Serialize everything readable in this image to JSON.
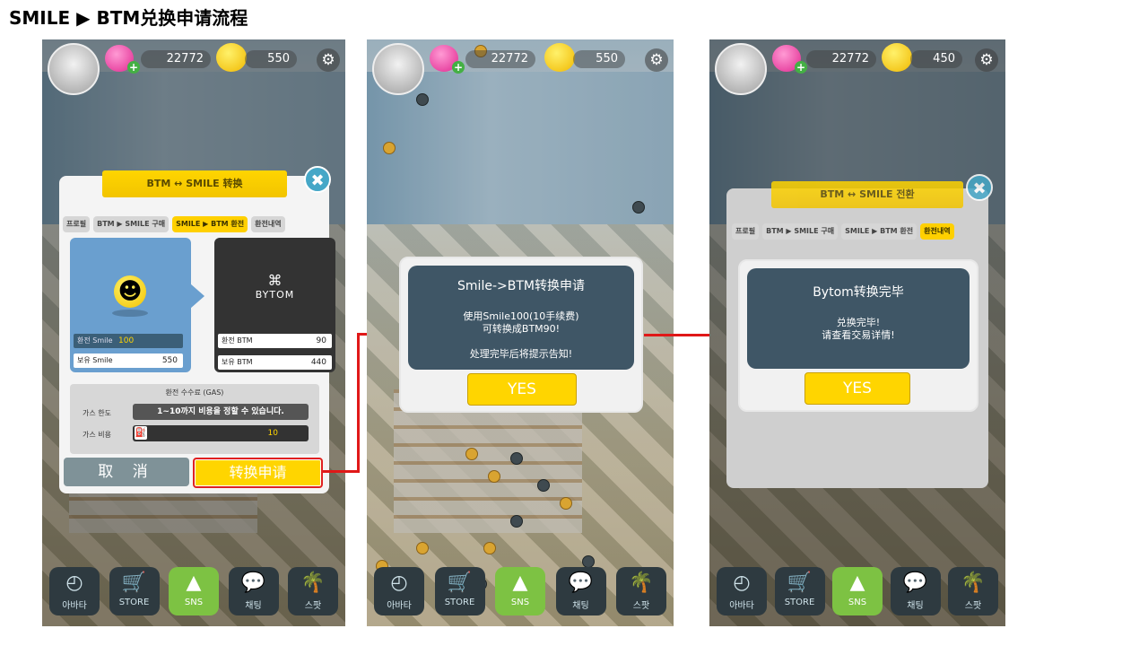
{
  "page": {
    "title": "SMILE ▶ BTM兑换申请流程"
  },
  "panel1": {
    "hud": {
      "hearts": "22772",
      "smiles": "550",
      "gear_icon": "gear-icon"
    },
    "dialog": {
      "ribbon": "BTM ↔ SMILE 转换",
      "tabs": [
        "프로필",
        "BTM ▶ SMILE 구매",
        "SMILE ▶ BTM 환전",
        "환전내역"
      ],
      "active_tab_index": 2,
      "smile_card": {
        "exchange_label": "환전 Smile",
        "exchange_value": "100",
        "hold_label": "보유 Smile",
        "hold_value": "550"
      },
      "btm_card": {
        "logo_text": "BYTOM",
        "exchange_label": "환전 BTM",
        "exchange_value": "90",
        "hold_label": "보유 BTM",
        "hold_value": "440"
      },
      "gas": {
        "title": "환전 수수료 (GAS)",
        "limit_label": "가스 한도",
        "limit_text": "1~10까지 비용을 정할 수 있습니다.",
        "cost_label": "가스 비용",
        "cost_value": "10"
      },
      "cancel_label": "取 消",
      "apply_label": "转换申请"
    },
    "bottom": [
      "아바타",
      "STORE",
      "SNS",
      "채팅",
      "스팟"
    ]
  },
  "panel2": {
    "hud": {
      "hearts": "22772",
      "smiles": "550"
    },
    "popup": {
      "title": "Smile->BTM转换申请",
      "line1": "使用Smile100(10手续费)",
      "line2": "可转换成BTM90!",
      "line3": "处理完毕后将提示告知!",
      "yes_label": "YES"
    },
    "bottom": [
      "아바타",
      "STORE",
      "SNS",
      "채팅",
      "스팟"
    ]
  },
  "panel3": {
    "hud": {
      "hearts": "22772",
      "smiles": "450"
    },
    "dialog": {
      "ribbon": "BTM ↔ SMILE 전환",
      "tabs": [
        "프로필",
        "BTM ▶ SMILE 구매",
        "SMILE ▶ BTM 환전",
        "환전내역"
      ],
      "active_tab_index": 3
    },
    "popup": {
      "title": "Bytom转换完毕",
      "line1": "兑换完毕!",
      "line2": "请查看交易详情!",
      "yes_label": "YES"
    },
    "bottom": [
      "아바타",
      "STORE",
      "SNS",
      "채팅",
      "스팟"
    ]
  },
  "colors": {
    "accent": "#ffd500",
    "popup_inner": "#3f5666",
    "arrow": "#e01818"
  }
}
